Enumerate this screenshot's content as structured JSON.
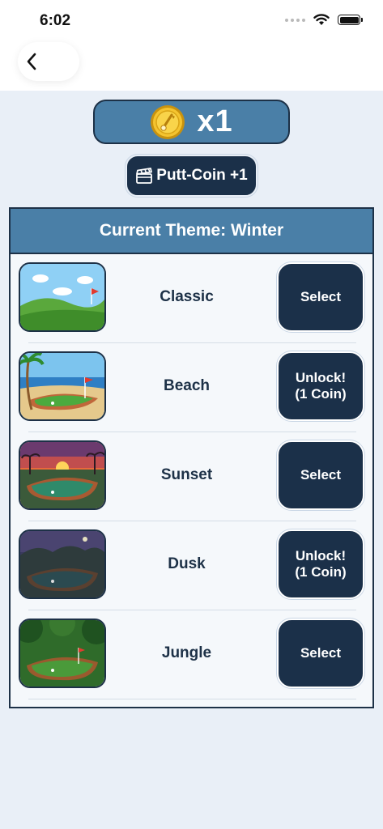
{
  "status_bar": {
    "time": "6:02"
  },
  "nav": {
    "back_icon": "chevron-left-icon"
  },
  "coins": {
    "icon": "golf-coin-icon",
    "count": "x1"
  },
  "reward_button": {
    "icon": "clapperboard-icon",
    "label": "Putt-Coin +1"
  },
  "theme_panel": {
    "title": "Current Theme: Winter",
    "themes": [
      {
        "name": "Classic",
        "action": "Select"
      },
      {
        "name": "Beach",
        "action": "Unlock!\n(1 Coin)"
      },
      {
        "name": "Sunset",
        "action": "Select"
      },
      {
        "name": "Dusk",
        "action": "Unlock!\n(1 Coin)"
      },
      {
        "name": "Jungle",
        "action": "Select"
      }
    ]
  },
  "colors": {
    "accent_blue": "#4a7fa7",
    "navy": "#1b3049",
    "background": "#e9eff7"
  }
}
